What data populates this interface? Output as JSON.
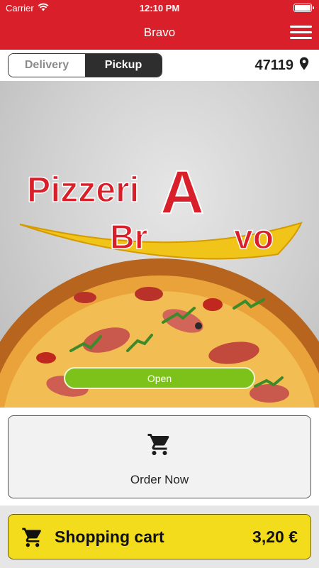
{
  "status_bar": {
    "carrier": "Carrier",
    "time": "12:10 PM"
  },
  "header": {
    "title": "Bravo"
  },
  "mode": {
    "delivery_label": "Delivery",
    "pickup_label": "Pickup",
    "selected": "Pickup",
    "postal_code": "47119"
  },
  "hero": {
    "logo_line1": "Pizzeri",
    "logo_line1_A": "A",
    "logo_line2": "Br",
    "logo_line2_A": "A",
    "logo_line2_end": "vo",
    "status": "Open"
  },
  "order": {
    "label": "Order Now"
  },
  "cart": {
    "label": "Shopping cart",
    "amount": "3,20 €"
  },
  "colors": {
    "brand_red": "#d9202a",
    "open_green": "#7cc21b",
    "cart_yellow": "#f2dc1c",
    "selected_segment": "#2e2e2e"
  },
  "icons": {
    "menu": "hamburger-icon",
    "location": "map-pin-icon",
    "cart": "cart-icon",
    "wifi": "wifi-icon",
    "battery": "battery-icon"
  }
}
